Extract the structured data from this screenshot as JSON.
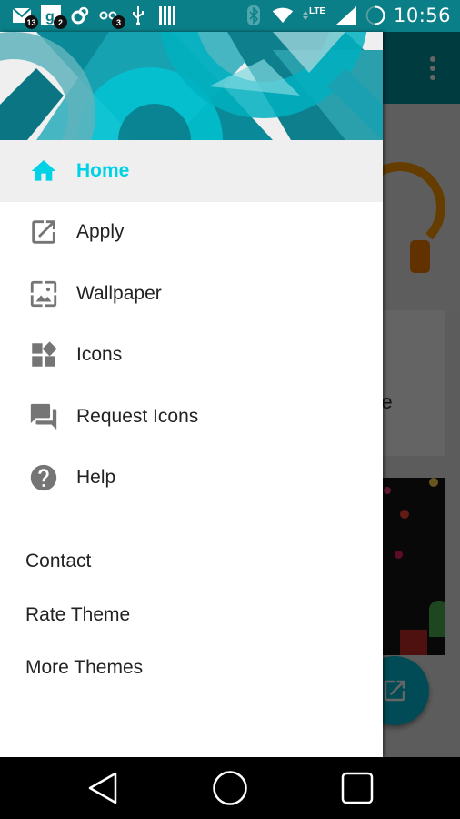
{
  "status_bar": {
    "notifications": [
      {
        "icon": "gmail-icon",
        "badge": "13"
      },
      {
        "icon": "google-plus-icon",
        "badge": "2"
      },
      {
        "icon": "sync-icon",
        "badge": ""
      },
      {
        "icon": "voicemail-icon",
        "badge": "3"
      },
      {
        "icon": "usb-icon",
        "badge": ""
      },
      {
        "icon": "barcode-icon",
        "badge": ""
      }
    ],
    "network_type": "LTE",
    "time": "10:56"
  },
  "drawer": {
    "primary_items": [
      {
        "label": "Home",
        "icon": "home-icon",
        "active": true
      },
      {
        "label": "Apply",
        "icon": "open-in-new-icon",
        "active": false
      },
      {
        "label": "Wallpaper",
        "icon": "wallpaper-icon",
        "active": false
      },
      {
        "label": "Icons",
        "icon": "widgets-icon",
        "active": false
      },
      {
        "label": "Request Icons",
        "icon": "forum-icon",
        "active": false
      },
      {
        "label": "Help",
        "icon": "help-icon",
        "active": false
      }
    ],
    "secondary_items": [
      {
        "label": "Contact"
      },
      {
        "label": "Rate Theme"
      },
      {
        "label": "More Themes"
      }
    ]
  },
  "background_app": {
    "card_text_fragment": "re"
  },
  "colors": {
    "accent": "#00d2e6",
    "status_bar": "#0b7f88",
    "toolbar": "#00959f",
    "icon_gray": "#757575"
  }
}
